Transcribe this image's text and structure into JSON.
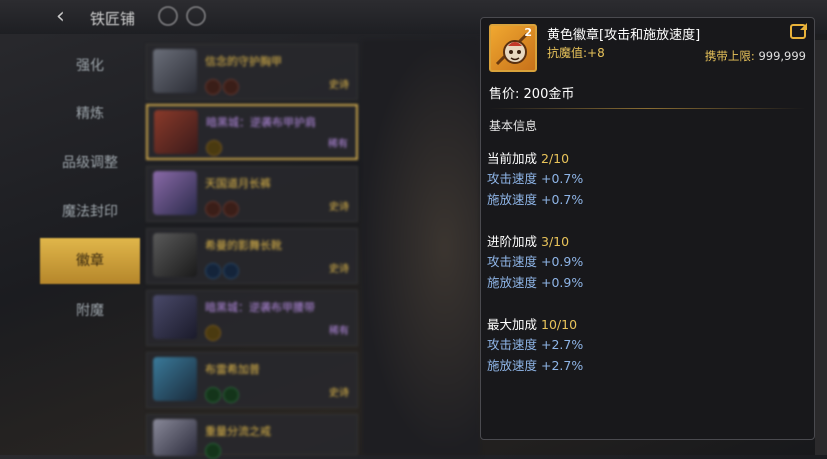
{
  "header": {
    "title": "铁匠铺",
    "back_icon": "arrow-left-icon"
  },
  "sidebar": {
    "items": [
      {
        "label": "强化"
      },
      {
        "label": "精炼"
      },
      {
        "label": "品级调整"
      },
      {
        "label": "魔法封印"
      },
      {
        "label": "徽章",
        "active": true
      },
      {
        "label": "附魔"
      }
    ]
  },
  "item_list": [
    {
      "name": "信念的守护胸甲",
      "tag": "史诗",
      "rarity": "epic"
    },
    {
      "name": "暗黑城：逆袭布甲护肩",
      "tag": "稀有",
      "rarity": "rare",
      "selected": true
    },
    {
      "name": "天国道月长裤",
      "tag": "史诗",
      "rarity": "epic"
    },
    {
      "name": "希曼的影舞长靴",
      "tag": "史诗",
      "rarity": "epic"
    },
    {
      "name": "暗黑城：逆袭布甲腰带",
      "tag": "稀有",
      "rarity": "rare"
    },
    {
      "name": "布雷希加普",
      "tag": "史诗",
      "rarity": "epic"
    },
    {
      "name": "重量分流之戒",
      "tag": "史诗",
      "rarity": "epic"
    }
  ],
  "tooltip": {
    "item_name": "黄色徽章[攻击和施放速度]",
    "icon_number": "2",
    "enchant_label": "抗魔值:",
    "enchant_value": "+8",
    "carry_label": "携带上限:",
    "carry_value": "999,999",
    "price_label": "售价:",
    "price_value": "200金币",
    "section_title": "基本信息",
    "groups": [
      {
        "label": "当前加成",
        "level": "2/10",
        "stats": [
          {
            "name": "攻击速度",
            "value": "+0.7%"
          },
          {
            "name": "施放速度",
            "value": "+0.7%"
          }
        ]
      },
      {
        "label": "进阶加成",
        "level": "3/10",
        "stats": [
          {
            "name": "攻击速度",
            "value": "+0.9%"
          },
          {
            "name": "施放速度",
            "value": "+0.9%"
          }
        ]
      },
      {
        "label": "最大加成",
        "level": "10/10",
        "stats": [
          {
            "name": "攻击速度",
            "value": "+2.7%"
          },
          {
            "name": "施放速度",
            "value": "+2.7%"
          }
        ]
      }
    ]
  },
  "colors": {
    "gold": "#e8c35a",
    "stat_blue": "#8eb4e6",
    "rare_purple": "#b48ae0"
  }
}
